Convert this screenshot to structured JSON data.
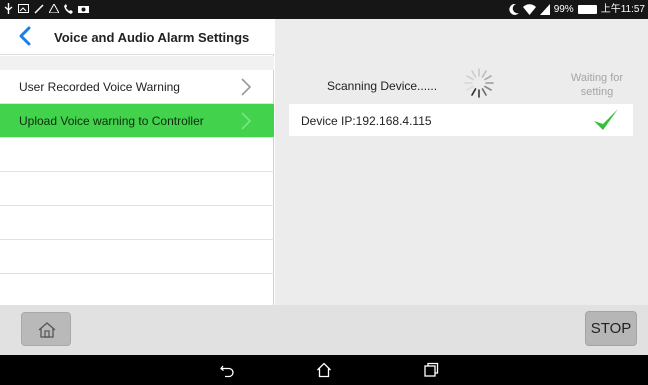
{
  "statusbar": {
    "battery_percent": "99%",
    "time": "上午11:57"
  },
  "header": {
    "title": "Voice and Audio Alarm Settings"
  },
  "menu": {
    "items": [
      {
        "label": "User Recorded Voice Warning",
        "active": false
      },
      {
        "label": "Upload Voice warning to Controller",
        "active": true
      }
    ]
  },
  "main": {
    "scanning_text": "Scanning Device......",
    "waiting_text": "Waiting for setting",
    "device_label": "Device IP:192.168.4.115"
  },
  "bottom": {
    "stop_label": "STOP"
  },
  "colors": {
    "accent_green": "#42d24c",
    "check_green": "#34c03b"
  }
}
